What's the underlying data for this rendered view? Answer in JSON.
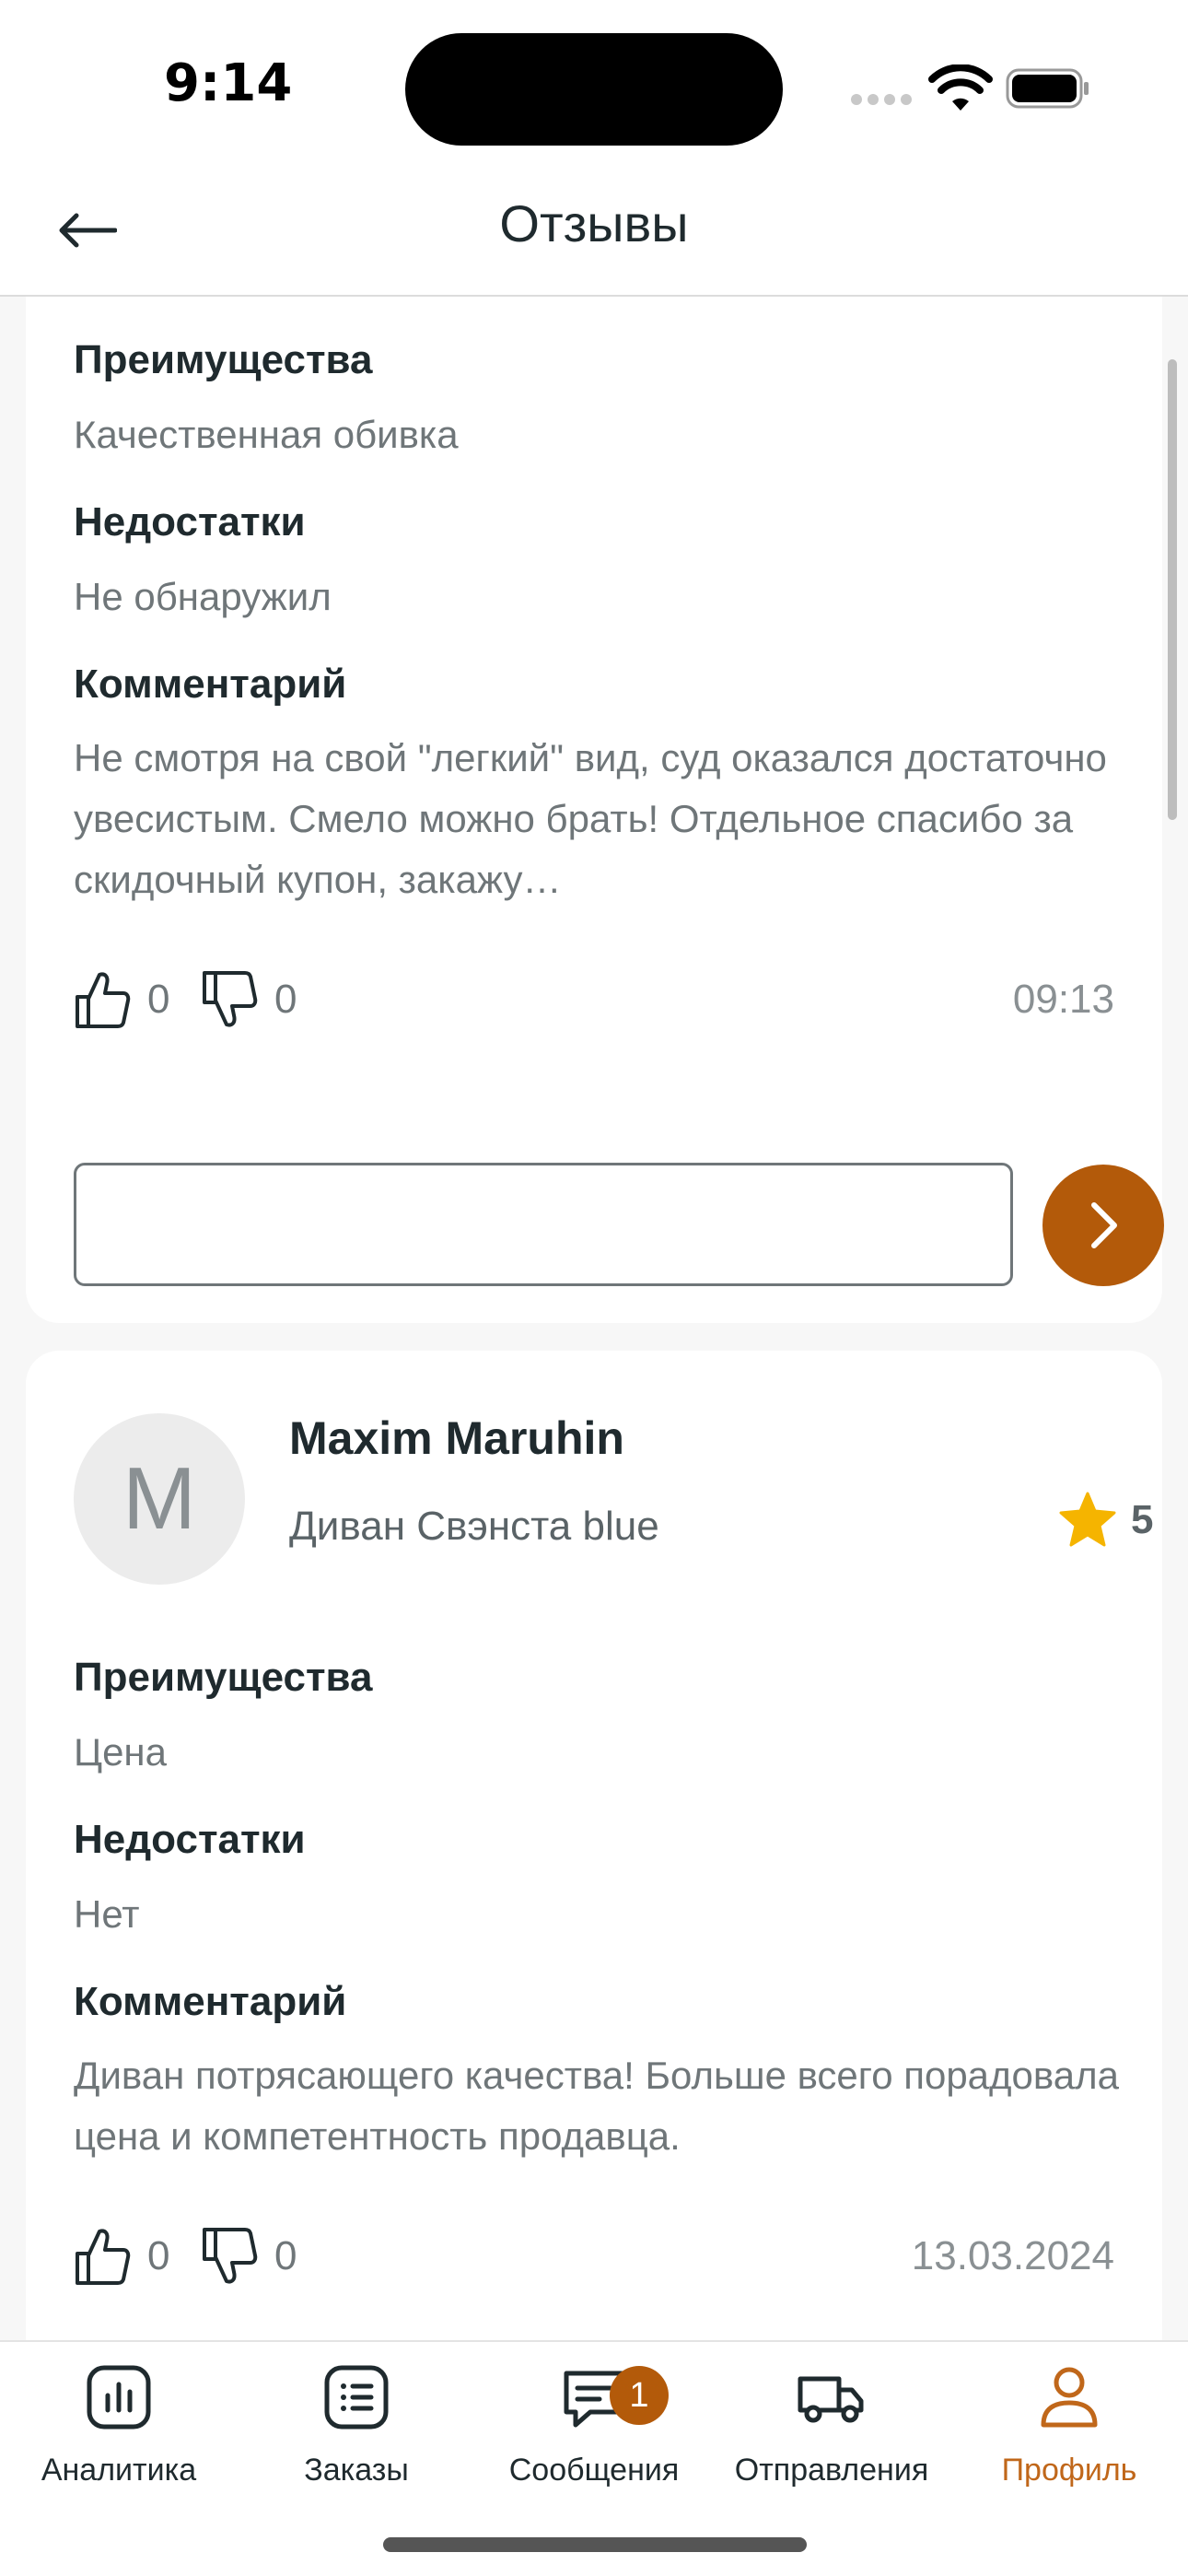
{
  "status": {
    "time": "9:14"
  },
  "nav": {
    "title": "Отзывы"
  },
  "review1": {
    "pros_label": "Преимущества",
    "pros": "Качественная обивка",
    "cons_label": "Недостатки",
    "cons": "Не обнаружил",
    "comment_label": "Комментарий",
    "comment": "Не смотря на свой \"легкий\" вид, суд оказался достаточно увесистым. Смело можно брать! Отдельное спасибо за скидочный купон, закажу…",
    "likes": "0",
    "dislikes": "0",
    "time": "09:13",
    "reply_value": ""
  },
  "review2": {
    "avatar_letter": "M",
    "author": "Maxim Maruhin",
    "product": "Диван Свэнста blue",
    "rating": "5",
    "pros_label": "Преимущества",
    "pros": "Цена",
    "cons_label": "Недостатки",
    "cons": "Нет",
    "comment_label": "Комментарий",
    "comment": "Диван потрясающего качества! Больше всего порадовала цена и компетентность продавца.",
    "likes": "0",
    "dislikes": "0",
    "date": "13.03.2024"
  },
  "tabs": [
    {
      "label": "Аналитика",
      "icon": "chart-icon"
    },
    {
      "label": "Заказы",
      "icon": "list-icon"
    },
    {
      "label": "Сообщения",
      "icon": "message-icon",
      "badge": "1"
    },
    {
      "label": "Отправления",
      "icon": "truck-icon"
    },
    {
      "label": "Профиль",
      "icon": "person-icon",
      "active": true
    }
  ],
  "colors": {
    "accent": "#b35a0a",
    "active_tab": "#c0671a",
    "star": "#f5b400"
  }
}
